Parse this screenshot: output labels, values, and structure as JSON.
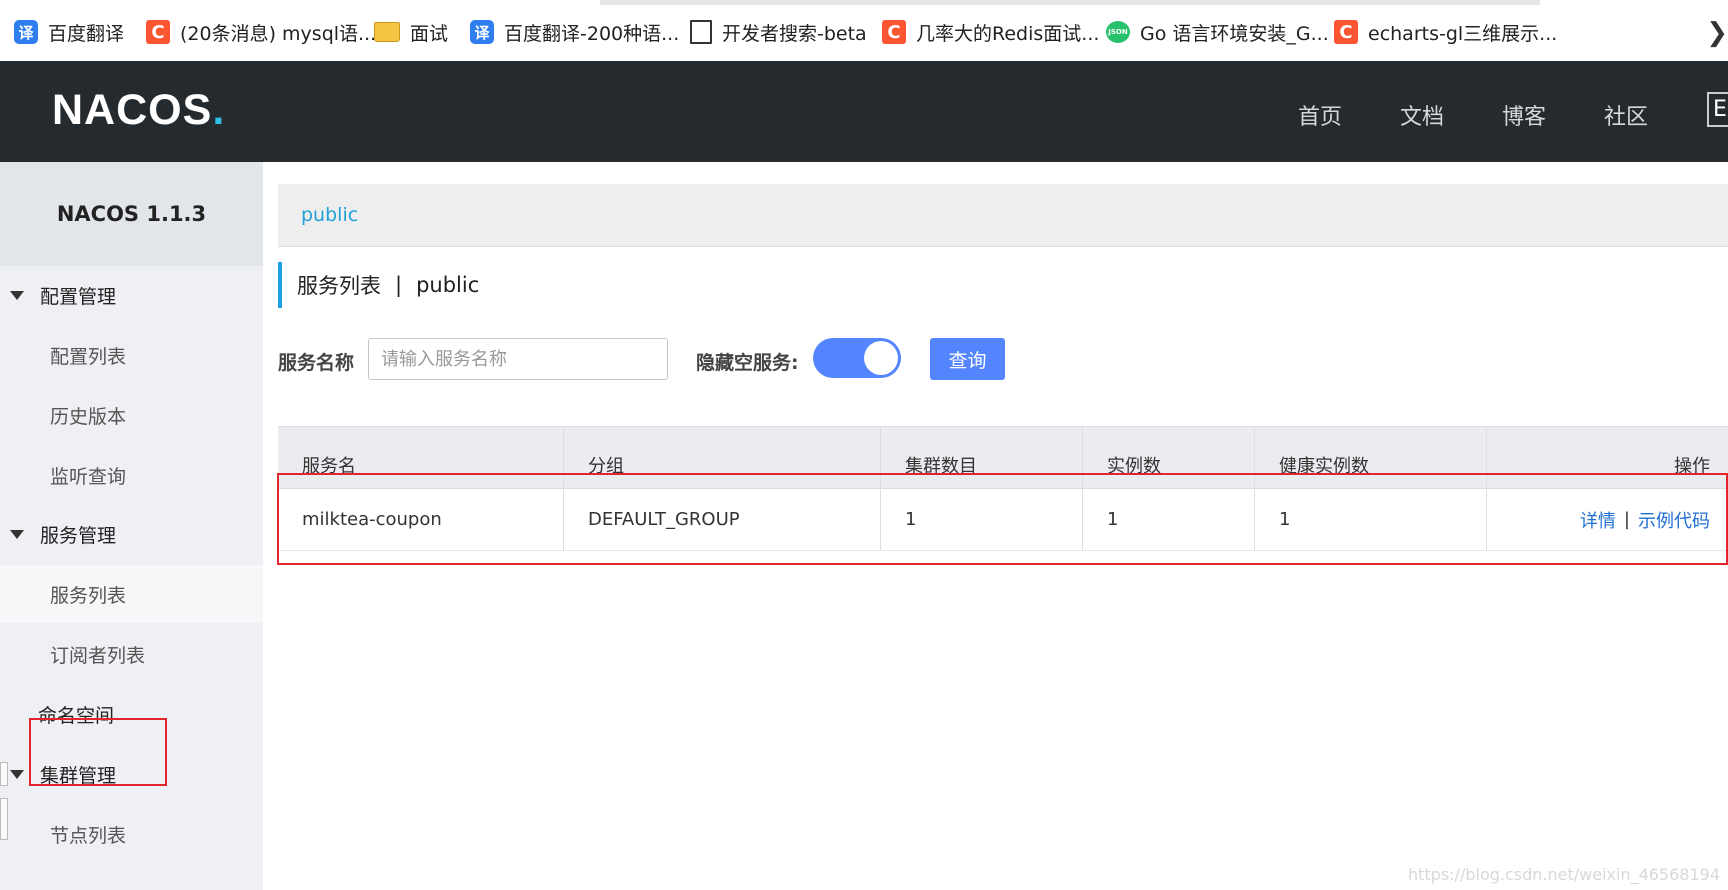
{
  "bookmarks": [
    {
      "icon": "translate-icon",
      "label": "百度翻译"
    },
    {
      "icon": "csdn-icon",
      "label": "(20条消息) mysql语..."
    },
    {
      "icon": "folder-icon",
      "label": "面试"
    },
    {
      "icon": "translate-icon",
      "label": "百度翻译-200种语..."
    },
    {
      "icon": "page-icon",
      "label": "开发者搜索-beta"
    },
    {
      "icon": "csdn-icon",
      "label": "几率大的Redis面试..."
    },
    {
      "icon": "json-icon",
      "label": "Go 语言环境安装_G..."
    },
    {
      "icon": "csdn-icon",
      "label": "echarts-gl三维展示..."
    }
  ],
  "bookmark_glyphs": {
    "translate": "译",
    "csdn": "C",
    "json": "JSON"
  },
  "header": {
    "logo": {
      "part1": "NA",
      "part2": "C",
      "part3": "OS",
      "dot": "."
    },
    "nav": [
      "首页",
      "文档",
      "博客",
      "社区"
    ],
    "lang_button": "En"
  },
  "sidebar": {
    "title": "NACOS 1.1.3",
    "groups": [
      {
        "label": "配置管理",
        "items": [
          "配置列表",
          "历史版本",
          "监听查询"
        ]
      },
      {
        "label": "服务管理",
        "items": [
          "服务列表",
          "订阅者列表"
        ]
      },
      {
        "label": "命名空间",
        "items": []
      },
      {
        "label": "集群管理",
        "items": [
          "节点列表"
        ]
      }
    ],
    "active_item": "服务列表"
  },
  "namespace_bar": {
    "current": "public"
  },
  "page_title": {
    "main": "服务列表",
    "separator": "|",
    "namespace": "public"
  },
  "search": {
    "service_name_label": "服务名称",
    "service_name_placeholder": "请输入服务名称",
    "service_name_value": "",
    "hide_empty_label": "隐藏空服务:",
    "hide_empty_enabled": true,
    "query_button": "查询"
  },
  "table": {
    "columns": [
      "服务名",
      "分组",
      "集群数目",
      "实例数",
      "健康实例数",
      "操作"
    ],
    "rows": [
      {
        "service_name": "milktea-coupon",
        "group": "DEFAULT_GROUP",
        "cluster_count": "1",
        "instance_count": "1",
        "healthy_instance_count": "1",
        "actions": [
          "详情",
          "示例代码"
        ],
        "action_separator": "|"
      }
    ]
  },
  "watermark": "https://blog.csdn.net/weixin_46568194",
  "colors": {
    "header_bg": "#252a2f",
    "accent": "#5584ff",
    "link": "#1f6fd3",
    "namespace_link": "#21a1d8",
    "annotation_red": "#e0262c"
  }
}
